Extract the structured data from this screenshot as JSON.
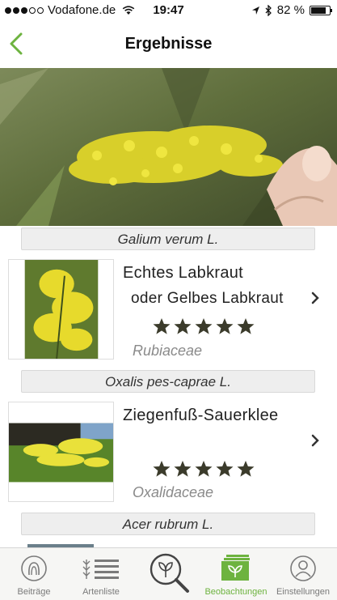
{
  "status_bar": {
    "carrier": "Vodafone.de",
    "time": "19:47",
    "battery": "82 %",
    "battery_level": 0.82
  },
  "nav": {
    "title": "Ergebnisse"
  },
  "results": [
    {
      "scientific_name": "Galium verum L.",
      "common_name": "Echtes Labkraut",
      "common_name_alt": "oder Gelbes Labkraut",
      "rating": 5,
      "family": "Rubiaceae"
    },
    {
      "scientific_name": "Oxalis pes-caprae L.",
      "common_name": "Ziegenfuß-Sauerklee",
      "rating": 5,
      "family": "Oxalidaceae"
    },
    {
      "scientific_name": "Acer rubrum L."
    }
  ],
  "tabs": [
    {
      "label": "Beiträge",
      "icon": "contributions-icon"
    },
    {
      "label": "Artenliste",
      "icon": "species-list-icon"
    },
    {
      "label": "",
      "icon": "identify-search-icon"
    },
    {
      "label": "Beobachtungen",
      "icon": "observations-icon",
      "active": true
    },
    {
      "label": "Einstellungen",
      "icon": "settings-profile-icon"
    }
  ],
  "colors": {
    "accent": "#6db33f",
    "star": "#3b3b2b",
    "header_bg": "#eeeeee"
  }
}
